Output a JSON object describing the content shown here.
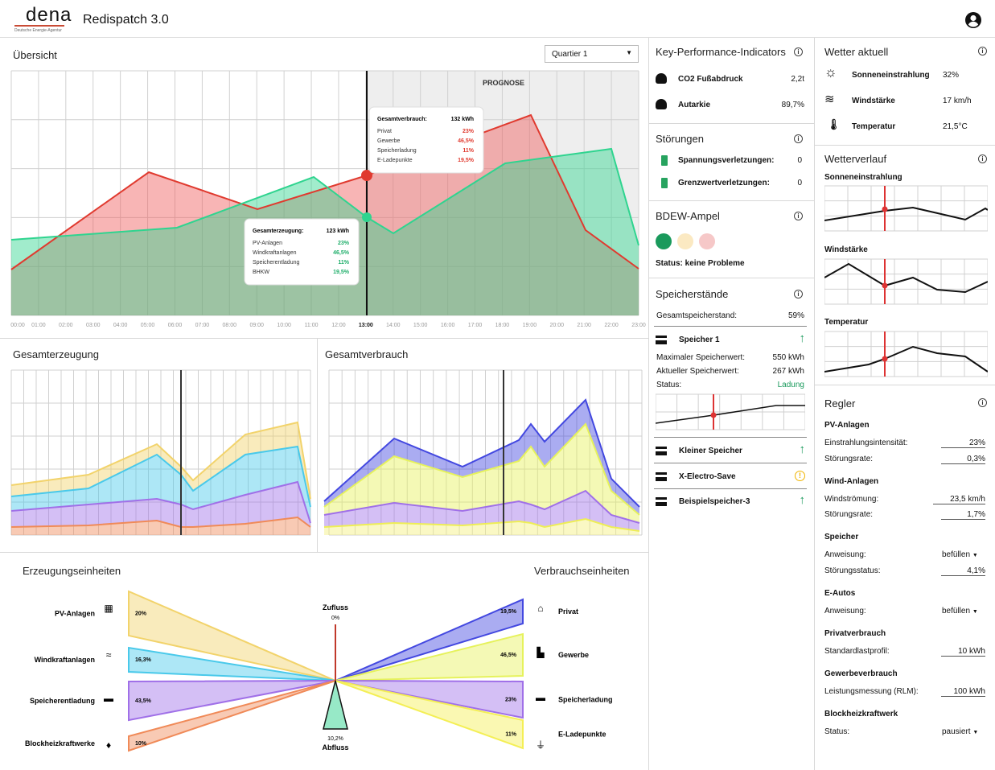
{
  "header": {
    "logo": "dena",
    "logo_sub": "Deutsche Energie-Agentur",
    "title": "Redispatch 3.0"
  },
  "overview": {
    "title": "Übersicht",
    "quarter": "Quartier 1",
    "prognose": "PROGNOSE",
    "times": [
      "00:00",
      "01:00",
      "02:00",
      "03:00",
      "04:00",
      "05:00",
      "06:00",
      "07:00",
      "08:00",
      "09:00",
      "10:00",
      "11:00",
      "12:00",
      "13:00",
      "14:00",
      "15:00",
      "16:00",
      "17:00",
      "18:00",
      "19:00",
      "20:00",
      "21:00",
      "22:00",
      "23:00"
    ],
    "tip_cons": {
      "title": "Gesamtverbrauch:",
      "value": "132 kWh",
      "rows": [
        [
          "Privat",
          "23%"
        ],
        [
          "Gewerbe",
          "46,5%"
        ],
        [
          "Speicherladung",
          "11%"
        ],
        [
          "E-Ladepunkte",
          "19,5%"
        ]
      ]
    },
    "tip_gen": {
      "title": "Gesamterzeugung:",
      "value": "123 kWh",
      "rows": [
        [
          "PV-Anlagen",
          "23%"
        ],
        [
          "Windkraftanlagen",
          "46,5%"
        ],
        [
          "Speicherentladung",
          "11%"
        ],
        [
          "BHKW",
          "19,5%"
        ]
      ]
    }
  },
  "gen_title": "Gesamterzeugung",
  "cons_title": "Gesamtverbrauch",
  "flow": {
    "left_title": "Erzeugungseinheiten",
    "right_title": "Verbrauchseinheiten",
    "left": [
      {
        "label": "PV-Anlagen",
        "pct": "20%",
        "icon": "solar-panel-icon"
      },
      {
        "label": "Windkraftanlagen",
        "pct": "16,3%",
        "icon": "wind-icon"
      },
      {
        "label": "Speicherentladung",
        "pct": "43,5%",
        "icon": "storage-icon"
      },
      {
        "label": "Blockheizkraftwerke",
        "pct": "10%",
        "icon": "flame-icon"
      }
    ],
    "right": [
      {
        "label": "Privat",
        "pct": "19,5%",
        "icon": "house-icon"
      },
      {
        "label": "Gewerbe",
        "pct": "46,5%",
        "icon": "factory-icon"
      },
      {
        "label": "Speicherladung",
        "pct": "23%",
        "icon": "storage-icon"
      },
      {
        "label": "E-Ladepunkte",
        "pct": "11%",
        "icon": "plug-icon"
      }
    ],
    "inflow": "Zufluss",
    "inflow_pct": "0%",
    "outflow": "Abfluss",
    "outflow_pct": "10,2%"
  },
  "kpi": {
    "title": "Key-Performance-Indicators",
    "rows": [
      {
        "label": "CO2 Fußabdruck",
        "value": "2,2t"
      },
      {
        "label": "Autarkie",
        "value": "89,7%"
      }
    ]
  },
  "disturb": {
    "title": "Störungen",
    "rows": [
      {
        "label": "Spannungsverletzungen:",
        "value": "0"
      },
      {
        "label": "Grenzwertverletzungen:",
        "value": "0"
      }
    ]
  },
  "bdew": {
    "title": "BDEW-Ampel",
    "status": "Status: keine Probleme"
  },
  "storage": {
    "title": "Speicherstände",
    "total_label": "Gesamtspeicherstand:",
    "total_value": "59%",
    "s1": {
      "name": "Speicher 1",
      "max_label": "Maximaler Speicherwert:",
      "max_value": "550 kWh",
      "cur_label": "Aktueller Speicherwert:",
      "cur_value": "267 kWh",
      "status_label": "Status:",
      "status_value": "Ladung"
    },
    "others": [
      "Kleiner Speicher",
      "X-Electro-Save",
      "Beispielspeicher-3"
    ]
  },
  "weather": {
    "title": "Wetter aktuell",
    "rows": [
      {
        "label": "Sonneneinstrahlung",
        "value": "32%"
      },
      {
        "label": "Windstärke",
        "value": "17 km/h"
      },
      {
        "label": "Temperatur",
        "value": "21,5°C"
      }
    ]
  },
  "wv": {
    "title": "Wetterverlauf",
    "charts": [
      "Sonneneinstrahlung",
      "Windstärke",
      "Temperatur"
    ]
  },
  "regler": {
    "title": "Regler",
    "pv": {
      "title": "PV-Anlagen",
      "r1": "Einstrahlungsintensität:",
      "v1": "23%",
      "r2": "Störungsrate:",
      "v2": "0,3%"
    },
    "wind": {
      "title": "Wind-Anlagen",
      "r1": "Windströmung:",
      "v1": "23,5 km/h",
      "r2": "Störungsrate:",
      "v2": "1,7%"
    },
    "sp": {
      "title": "Speicher",
      "r1": "Anweisung:",
      "v1": "befüllen",
      "r2": "Störungsstatus:",
      "v2": "4,1%"
    },
    "ea": {
      "title": "E-Autos",
      "r1": "Anweisung:",
      "v1": "befüllen"
    },
    "pvb": {
      "title": "Privatverbrauch",
      "r1": "Standardlastprofil:",
      "v1": "10 kWh"
    },
    "gvb": {
      "title": "Gewerbeverbrauch",
      "r1": "Leistungsmessung (RLM):",
      "v1": "100 kWh"
    },
    "bhkw": {
      "title": "Blockheizkraftwerk",
      "r1": "Status:",
      "v1": "pausiert"
    }
  },
  "colors": {
    "red": "#e03a2f",
    "green": "#2fd48f",
    "yellow": "#f2d36b",
    "cyan": "#49c9ea",
    "purple": "#a070e8",
    "orange": "#f08a58",
    "blue": "#4348e0",
    "lime": "#e6f25c",
    "status_green": "#1a9a5c"
  }
}
